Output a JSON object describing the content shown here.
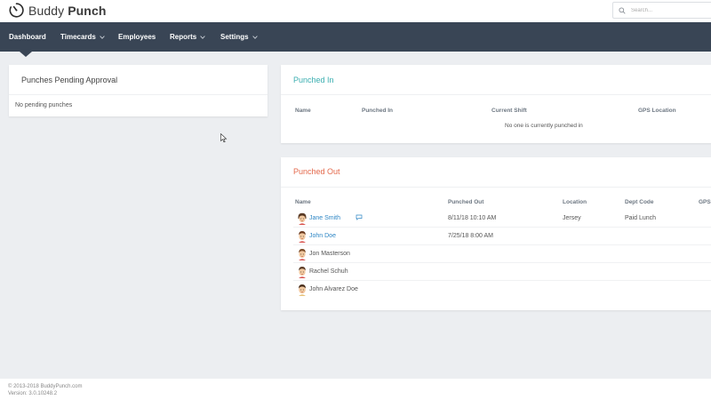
{
  "brand": {
    "name_light": "Buddy",
    "name_bold": "Punch",
    "logo_icon": "clock-icon"
  },
  "search": {
    "placeholder": "Search..."
  },
  "nav": {
    "items": [
      {
        "label": "Dashboard",
        "active": true,
        "has_caret": false
      },
      {
        "label": "Timecards",
        "active": false,
        "has_caret": true
      },
      {
        "label": "Employees",
        "active": false,
        "has_caret": false
      },
      {
        "label": "Reports",
        "active": false,
        "has_caret": true
      },
      {
        "label": "Settings",
        "active": false,
        "has_caret": true
      }
    ]
  },
  "pending": {
    "title": "Punches Pending Approval",
    "empty": "No pending punches"
  },
  "punched_in": {
    "title": "Punched In",
    "columns": [
      "Name",
      "Punched In",
      "Current Shift",
      "GPS Location"
    ],
    "empty": "No one is currently punched in"
  },
  "punched_out": {
    "title": "Punched Out",
    "columns": [
      "Name",
      "Punched Out",
      "Location",
      "Dept Code",
      "GPS"
    ],
    "rows": [
      {
        "name": "Jane Smith",
        "link": true,
        "has_comment": true,
        "punched_out": "8/11/18 10:10 AM",
        "location": "Jersey",
        "dept_code": "Paid Lunch"
      },
      {
        "name": "John Doe",
        "link": true,
        "has_comment": false,
        "punched_out": "7/25/18 8:00 AM",
        "location": "",
        "dept_code": ""
      },
      {
        "name": "Jon Masterson",
        "link": false,
        "has_comment": false,
        "punched_out": "",
        "location": "",
        "dept_code": ""
      },
      {
        "name": "Rachel Schuh",
        "link": false,
        "has_comment": false,
        "punched_out": "",
        "location": "",
        "dept_code": ""
      },
      {
        "name": "John Alvarez Doe",
        "link": false,
        "has_comment": false,
        "punched_out": "",
        "location": "",
        "dept_code": ""
      }
    ]
  },
  "footer": {
    "copyright": "© 2013-2018 BuddyPunch.com",
    "version": "Version: 3.0.10248.2"
  },
  "colors": {
    "nav_bg": "#394555",
    "punched_in_title": "#3aaeb0",
    "punched_out_title": "#e46a4d",
    "link": "#2f87c5"
  }
}
